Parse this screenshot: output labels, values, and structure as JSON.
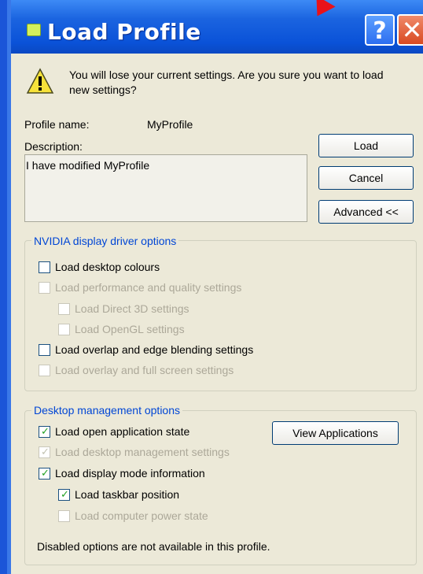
{
  "window": {
    "title": "Load Profile",
    "help_label": "?",
    "close_label": "✕"
  },
  "warning": {
    "icon": "warning-icon",
    "message_line1": "You will lose your current settings. Are you sure you want to load",
    "message_line2": "new settings?"
  },
  "profile": {
    "name_label": "Profile name:",
    "name_value": "MyProfile",
    "description_label": "Description:",
    "description_value": "I have modified MyProfile"
  },
  "buttons": {
    "load": "Load",
    "cancel": "Cancel",
    "advanced": "Advanced <<",
    "view_applications": "View Applications"
  },
  "nvidia_group": {
    "title": "NVIDIA display driver options",
    "options": [
      {
        "label": "Load desktop colours",
        "checked": false,
        "enabled": true
      },
      {
        "label": "Load performance and quality settings",
        "checked": false,
        "enabled": false
      },
      {
        "label": "Load Direct 3D settings",
        "checked": false,
        "enabled": false
      },
      {
        "label": "Load OpenGL settings",
        "checked": false,
        "enabled": false
      },
      {
        "label": "Load overlap and edge blending settings",
        "checked": false,
        "enabled": true
      },
      {
        "label": "Load overlay and full screen settings",
        "checked": false,
        "enabled": false
      }
    ]
  },
  "desktop_group": {
    "title": "Desktop management options",
    "options": [
      {
        "label": "Load open application state",
        "checked": true,
        "enabled": true
      },
      {
        "label": "Load desktop management settings",
        "checked": true,
        "enabled": false
      },
      {
        "label": "Load display mode information",
        "checked": true,
        "enabled": true
      },
      {
        "label": "Load taskbar position",
        "checked": true,
        "enabled": true
      },
      {
        "label": "Load computer power state",
        "checked": false,
        "enabled": false
      }
    ],
    "footnote": "Disabled options are not available in this profile."
  },
  "colors": {
    "titlebar": "#0a52d8",
    "group_title": "#0046d5",
    "close_button": "#d84a22",
    "dialog_background": "#ece9d8"
  }
}
